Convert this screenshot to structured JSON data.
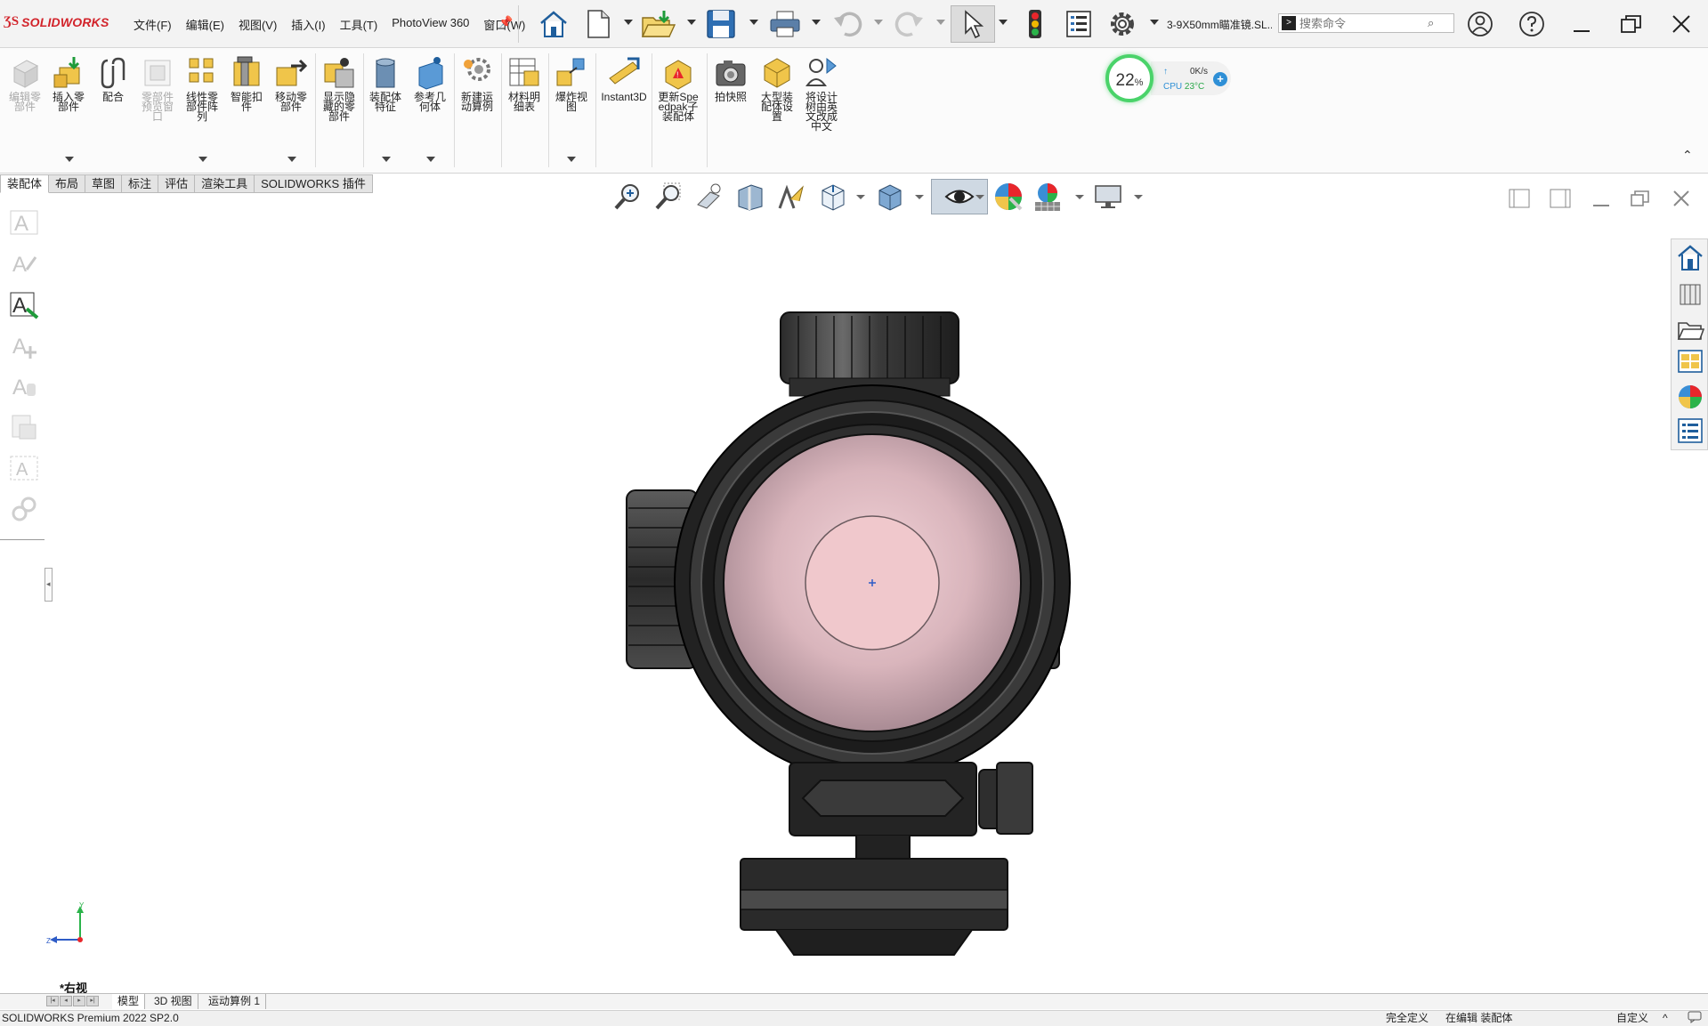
{
  "app": {
    "brand": "SOLIDWORKS",
    "document_title": "3-9X50mm瞄准镜.SL...",
    "search_placeholder": "搜索命令"
  },
  "menu": [
    "文件(F)",
    "编辑(E)",
    "视图(V)",
    "插入(I)",
    "工具(T)",
    "PhotoView 360",
    "窗口(W)"
  ],
  "quick_access": {
    "icons": [
      "home-icon",
      "new-document-icon",
      "open-icon",
      "save-icon",
      "print-icon",
      "undo-icon",
      "redo-icon",
      "select-icon",
      "rebuild-icon",
      "file-properties-icon",
      "options-icon"
    ]
  },
  "ribbon": {
    "buttons": [
      {
        "label": "编辑零部件",
        "icon": "edit-component-icon",
        "enabled": false
      },
      {
        "label": "插入零部件",
        "icon": "insert-component-icon",
        "enabled": true
      },
      {
        "label": "配合",
        "icon": "mate-icon",
        "enabled": true
      },
      {
        "label": "零部件预览窗口",
        "icon": "component-preview-icon",
        "enabled": false
      },
      {
        "label": "线性零部件阵列",
        "icon": "linear-pattern-icon",
        "enabled": true
      },
      {
        "label": "智能扣件",
        "icon": "smart-fasteners-icon",
        "enabled": true
      },
      {
        "label": "移动零部件",
        "icon": "move-component-icon",
        "enabled": true
      },
      {
        "label": "显示隐藏的零部件",
        "icon": "show-hidden-icon",
        "enabled": true
      },
      {
        "label": "装配体特征",
        "icon": "assembly-features-icon",
        "enabled": true
      },
      {
        "label": "参考几何体",
        "icon": "reference-geometry-icon",
        "enabled": true
      },
      {
        "label": "新建运动算例",
        "icon": "motion-study-icon",
        "enabled": true
      },
      {
        "label": "材料明细表",
        "icon": "bom-icon",
        "enabled": true
      },
      {
        "label": "爆炸视图",
        "icon": "exploded-view-icon",
        "enabled": true
      },
      {
        "label": "Instant3D",
        "icon": "instant3d-icon",
        "enabled": true
      },
      {
        "label": "更新Speedpak子装配体",
        "icon": "speedpak-icon",
        "enabled": true
      },
      {
        "label": "拍快照",
        "icon": "snapshot-icon",
        "enabled": true
      },
      {
        "label": "大型装配体设置",
        "icon": "large-assembly-icon",
        "enabled": true
      },
      {
        "label": "将设计树由英文改成中文",
        "icon": "design-tree-icon",
        "enabled": true
      }
    ]
  },
  "cpu_widget": {
    "percent": "22",
    "percent_sign": "%",
    "net_speed": "0K/s",
    "cpu_label": "CPU",
    "temperature": "23°C"
  },
  "tabs": [
    "装配体",
    "布局",
    "草图",
    "标注",
    "评估",
    "渲染工具",
    "SOLIDWORKS 插件"
  ],
  "active_tab": "装配体",
  "view": {
    "label": "*右视",
    "triad_y": "Y",
    "triad_z": "Z"
  },
  "bottom_tabs": [
    "模型",
    "3D 视图",
    "运动算例 1"
  ],
  "status": {
    "version": "SOLIDWORKS Premium 2022 SP2.0",
    "definition": "完全定义",
    "editing": "在编辑 装配体",
    "units": "自定义",
    "caret": "^"
  },
  "colors": {
    "brand_red": "#d2232a",
    "cpu_ring": "#4ad36a",
    "accent_blue": "#2e8fd6",
    "lens_pink": "#e6c4c9"
  }
}
